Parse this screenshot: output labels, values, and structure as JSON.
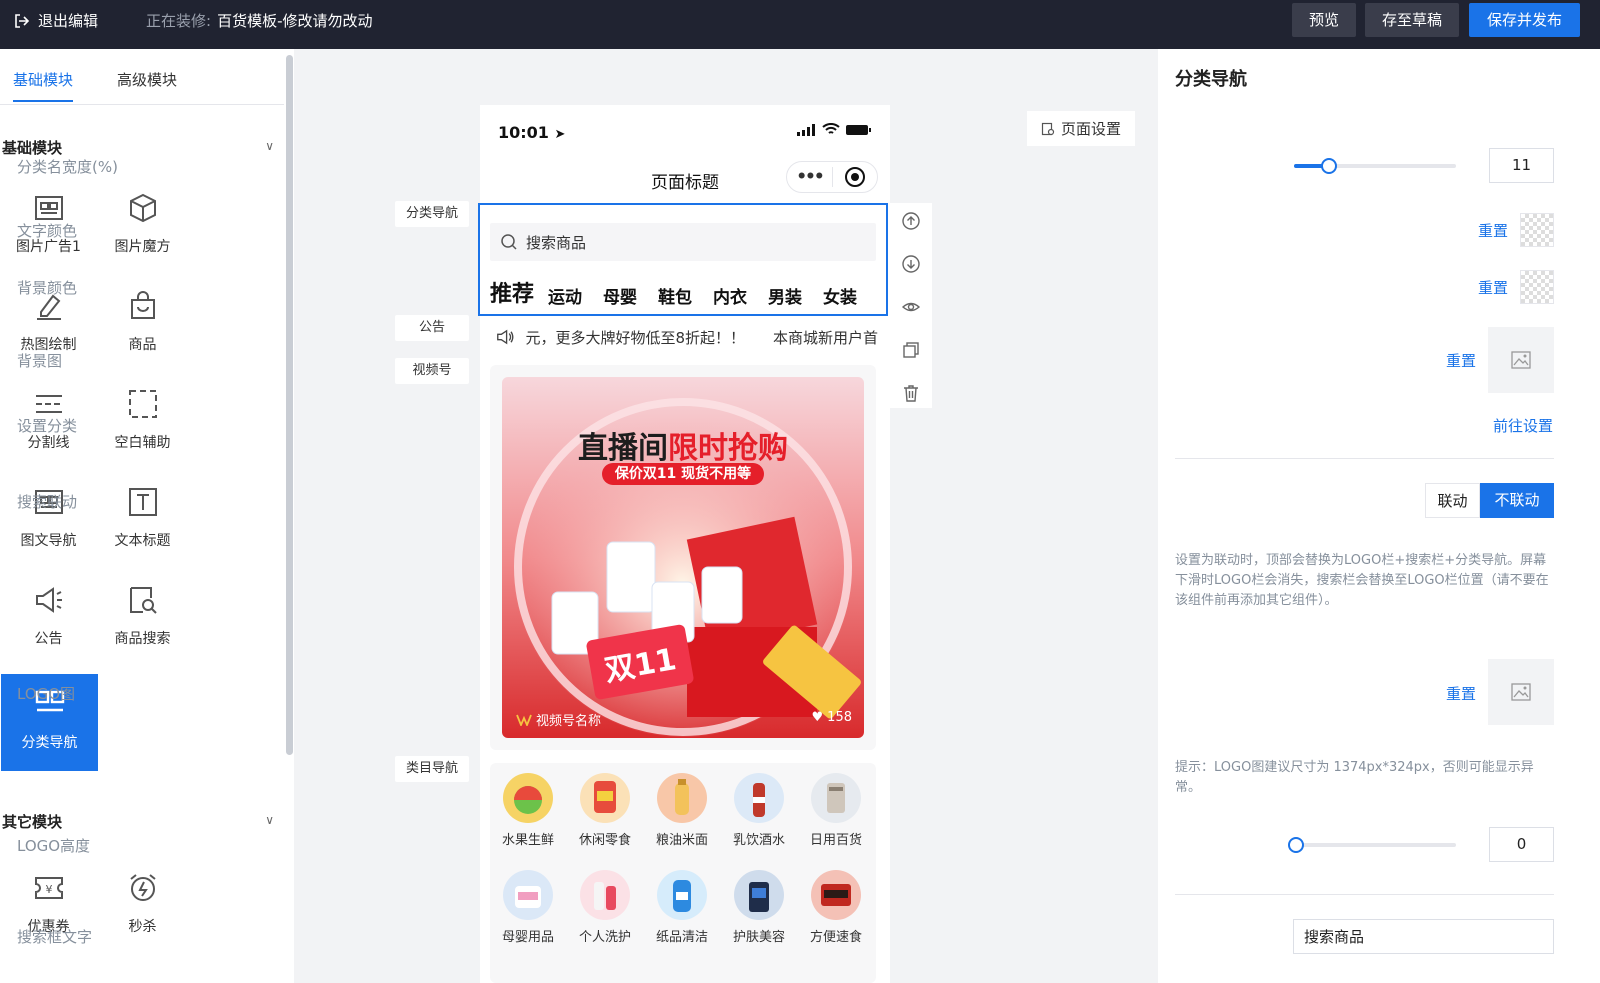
{
  "topbar": {
    "exit_label": "退出编辑",
    "editing_prefix": "正在装修:",
    "editing_name": "百货模板-修改请勿改动",
    "preview": "预览",
    "save_draft": "存至草稿",
    "save_publish": "保存并发布"
  },
  "left": {
    "tabs": [
      "基础模块",
      "高级模块"
    ],
    "basic_section": "基础模块",
    "other_section": "其它模块",
    "modules": [
      "图片广告1",
      "图片魔方",
      "热图绘制",
      "商品",
      "分割线",
      "空白辅助",
      "图文导航",
      "文本标题",
      "公告",
      "商品搜索",
      "分类导航"
    ],
    "other_modules": [
      "优惠券",
      "秒杀"
    ]
  },
  "canvas": {
    "labels": {
      "cat_nav": "分类导航",
      "notice": "公告",
      "video": "视频号",
      "category": "类目导航"
    },
    "time": "10:01",
    "page_title": "页面标题",
    "search_placeholder": "搜索商品",
    "categories": [
      "推荐",
      "运动",
      "母婴",
      "鞋包",
      "内衣",
      "男装",
      "女装"
    ],
    "notice_text": "元，更多大牌好物低至8折起！！",
    "notice_text2": "本商城新用户首",
    "banner_title_a": "直播间",
    "banner_title_b": "限时抢购",
    "banner_sub": "保价双11 现货不用等",
    "banner_big": "双11",
    "video_name": "视频号名称",
    "video_likes": "158",
    "grid": [
      "水果生鲜",
      "休闲零食",
      "粮油米面",
      "乳饮酒水",
      "日用百货",
      "母婴用品",
      "个人洗护",
      "纸品清洁",
      "护肤美容",
      "方便速食"
    ],
    "page_settings": "页面设置"
  },
  "right": {
    "title": "分类导航",
    "name_width_label": "分类名宽度(%)",
    "name_width_value": "11",
    "text_color": "文字颜色",
    "bg_color": "背景颜色",
    "bg_image": "背景图",
    "reset": "重置",
    "set_category": "设置分类",
    "go_settings": "前往设置",
    "search_link": "搜索联动",
    "link": "联动",
    "no_link": "不联动",
    "hint": "设置为联动时，顶部会替换为LOGO栏+搜索栏+分类导航。屏幕下滑时LOGO栏会消失，搜索栏会替换至LOGO栏位置（请不要在该组件前再添加其它组件）。",
    "logo_image": "LOGO图",
    "logo_hint": "提示：LOGO图建议尺寸为 1374px*324px，否则可能显示异常。",
    "logo_height": "LOGO高度",
    "logo_height_value": "0",
    "search_text_label": "搜索框文字",
    "search_text_value": "搜索商品"
  },
  "colors": {
    "accent": "#1a73e8",
    "topbar": "#202331"
  }
}
